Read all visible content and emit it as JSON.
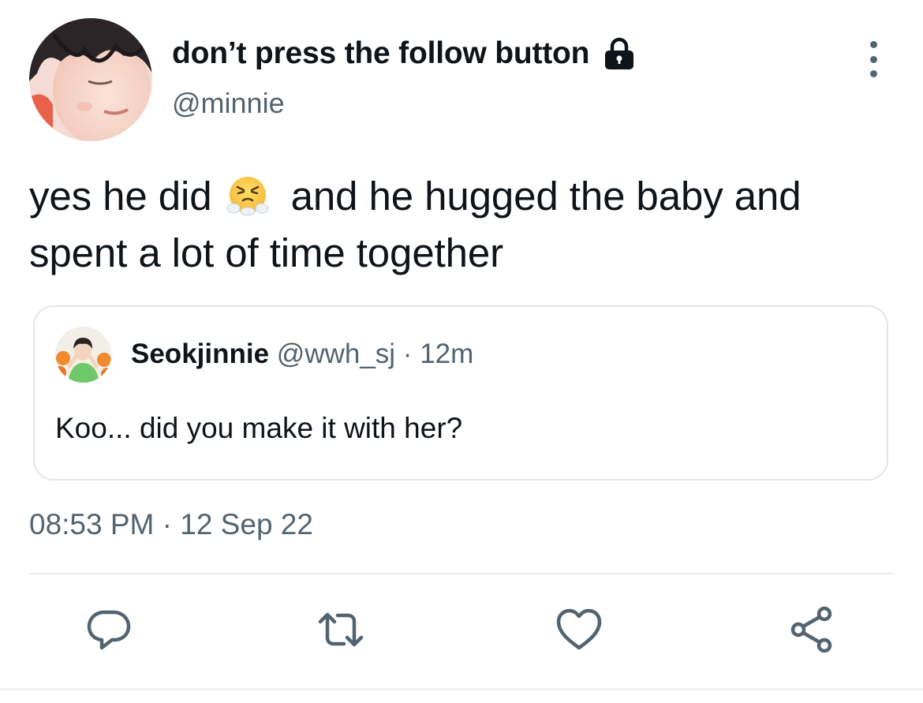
{
  "author": {
    "display_name": "don’t press the follow button",
    "handle": "@minnie",
    "protected": true
  },
  "tweet": {
    "text_before_emoji": "yes he did",
    "emoji": "face-with-steam-from-nose",
    "text_after_emoji": "and he hugged the baby and spent a lot of time together",
    "timestamp": "08:53 PM · 12 Sep 22"
  },
  "quoted_tweet": {
    "display_name": "Seokjinnie",
    "handle_and_time": "@wwh_sj · 12m",
    "text": "Koo... did you make it with her?"
  },
  "actions": [
    "reply-icon",
    "retweet-icon",
    "like-icon",
    "share-icon"
  ],
  "colors": {
    "text_primary": "#0f1419",
    "text_secondary": "#536471",
    "border": "#e1e6ea",
    "background": "#ffffff"
  }
}
